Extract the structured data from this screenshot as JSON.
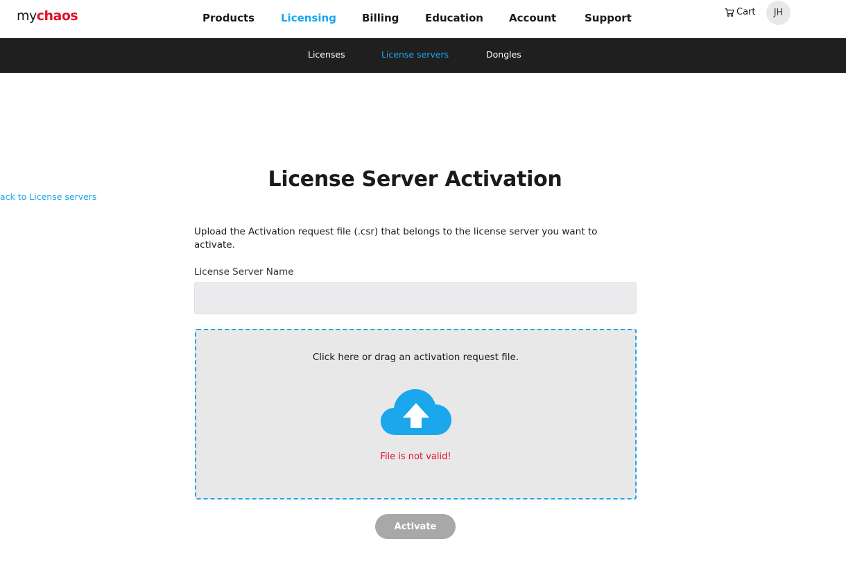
{
  "header": {
    "logo": {
      "prefix": "my",
      "brand": "chaos"
    },
    "nav": [
      {
        "label": "Products",
        "active": false
      },
      {
        "label": "Licensing",
        "active": true
      },
      {
        "label": "Billing",
        "active": false
      },
      {
        "label": "Education",
        "active": false
      },
      {
        "label": "Account",
        "active": false
      },
      {
        "label": "Support",
        "active": false
      }
    ],
    "cart_label": "Cart",
    "cart_icon": "cart-icon",
    "avatar_initials": "JH"
  },
  "subnav": {
    "items": [
      {
        "label": "Licenses",
        "active": false
      },
      {
        "label": "License servers",
        "active": true
      },
      {
        "label": "Dongles",
        "active": false
      }
    ]
  },
  "back_link": "ack to License servers",
  "page_title": "License Server Activation",
  "instructions": "Upload the Activation request file (.csr) that belongs to the license server you want to activate.",
  "form": {
    "server_name_label": "License Server Name",
    "server_name_value": "",
    "dropzone_text": "Click here or drag an activation request file.",
    "dropzone_icon": "cloud-upload-icon",
    "error_text": "File is not valid!",
    "activate_label": "Activate"
  },
  "colors": {
    "accent": "#1aa7ec",
    "brand_red": "#e0102a",
    "dark_bar": "#1f1f1f",
    "disabled_button": "#a8a8a8"
  }
}
